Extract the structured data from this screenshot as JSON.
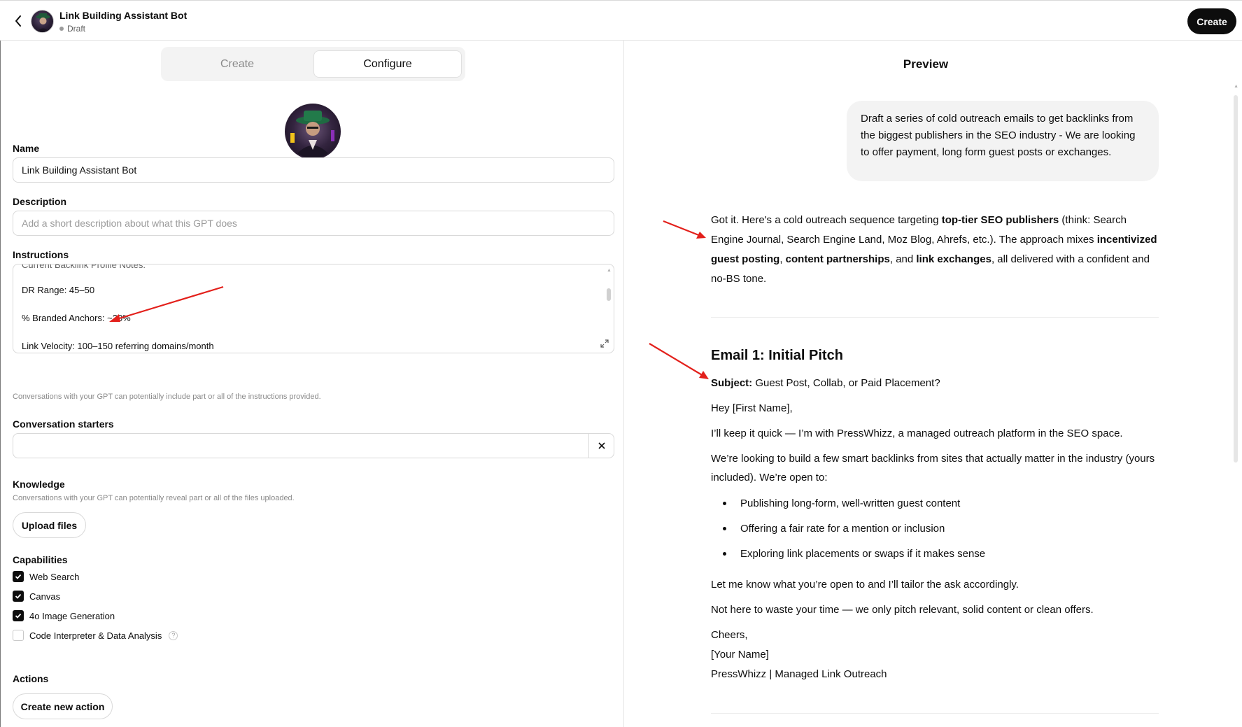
{
  "header": {
    "title": "Link Building Assistant Bot",
    "status": "Draft",
    "create_button": "Create"
  },
  "tabs": {
    "create": "Create",
    "configure": "Configure"
  },
  "name": {
    "label": "Name",
    "value": "Link Building Assistant Bot"
  },
  "description": {
    "label": "Description",
    "placeholder": "Add a short description about what this GPT does"
  },
  "instructions": {
    "label": "Instructions",
    "line_partial": "Current Backlink Profile Notes:",
    "line1": "DR Range: 45–50",
    "line2": "% Branded Anchors: ~20%",
    "line3": "Link Velocity: 100–150 referring domains/month",
    "helper": "Conversations with your GPT can potentially include part or all of the instructions provided."
  },
  "starters": {
    "label": "Conversation starters",
    "value": ""
  },
  "knowledge": {
    "label": "Knowledge",
    "helper": "Conversations with your GPT can potentially reveal part or all of the files uploaded.",
    "upload_button": "Upload files"
  },
  "capabilities": {
    "label": "Capabilities",
    "items": [
      {
        "label": "Web Search",
        "checked": true
      },
      {
        "label": "Canvas",
        "checked": true
      },
      {
        "label": "4o Image Generation",
        "checked": true
      },
      {
        "label": "Code Interpreter & Data Analysis",
        "checked": false
      }
    ]
  },
  "actions": {
    "label": "Actions",
    "create_button": "Create new action"
  },
  "preview": {
    "title": "Preview",
    "user_message": "Draft a series of cold outreach emails to get backlinks from the biggest publishers in the SEO industry - We are looking to offer payment, long form guest posts or exchanges.",
    "intro": {
      "p1": "Got it. Here's a cold outreach sequence targeting ",
      "b1": "top-tier SEO publishers",
      "p2": " (think: Search Engine Journal, Search Engine Land, Moz Blog, Ahrefs, etc.). The approach mixes ",
      "b2": "incentivized guest posting",
      "p3": ", ",
      "b3": "content partnerships",
      "p4": ", and ",
      "b4": "link exchanges",
      "p5": ", all delivered with a confident and no-BS tone."
    },
    "email1": {
      "heading": "Email 1: Initial Pitch",
      "subject_label": "Subject:",
      "subject": " Guest Post, Collab, or Paid Placement?",
      "greeting": "Hey [First Name],",
      "line1": "I’ll keep it quick — I’m with PressWhizz, a managed outreach platform in the SEO space.",
      "line2": "We’re looking to build a few smart backlinks from sites that actually matter in the industry (yours included). We’re open to:",
      "bullets": [
        "Publishing long-form, well-written guest content",
        "Offering a fair rate for a mention or inclusion",
        "Exploring link placements or swaps if it makes sense"
      ],
      "line3": "Let me know what you’re open to and I’ll tailor the ask accordingly.",
      "line4": "Not here to waste your time — we only pitch relevant, solid content or clean offers.",
      "signoff": "Cheers,",
      "name": "[Your Name]",
      "company": "PressWhizz | Managed Link Outreach"
    }
  },
  "colors": {
    "annotation_arrow": "#e3201b",
    "primary_dark": "#0d0d0d",
    "bubble_bg": "#f3f3f3"
  }
}
